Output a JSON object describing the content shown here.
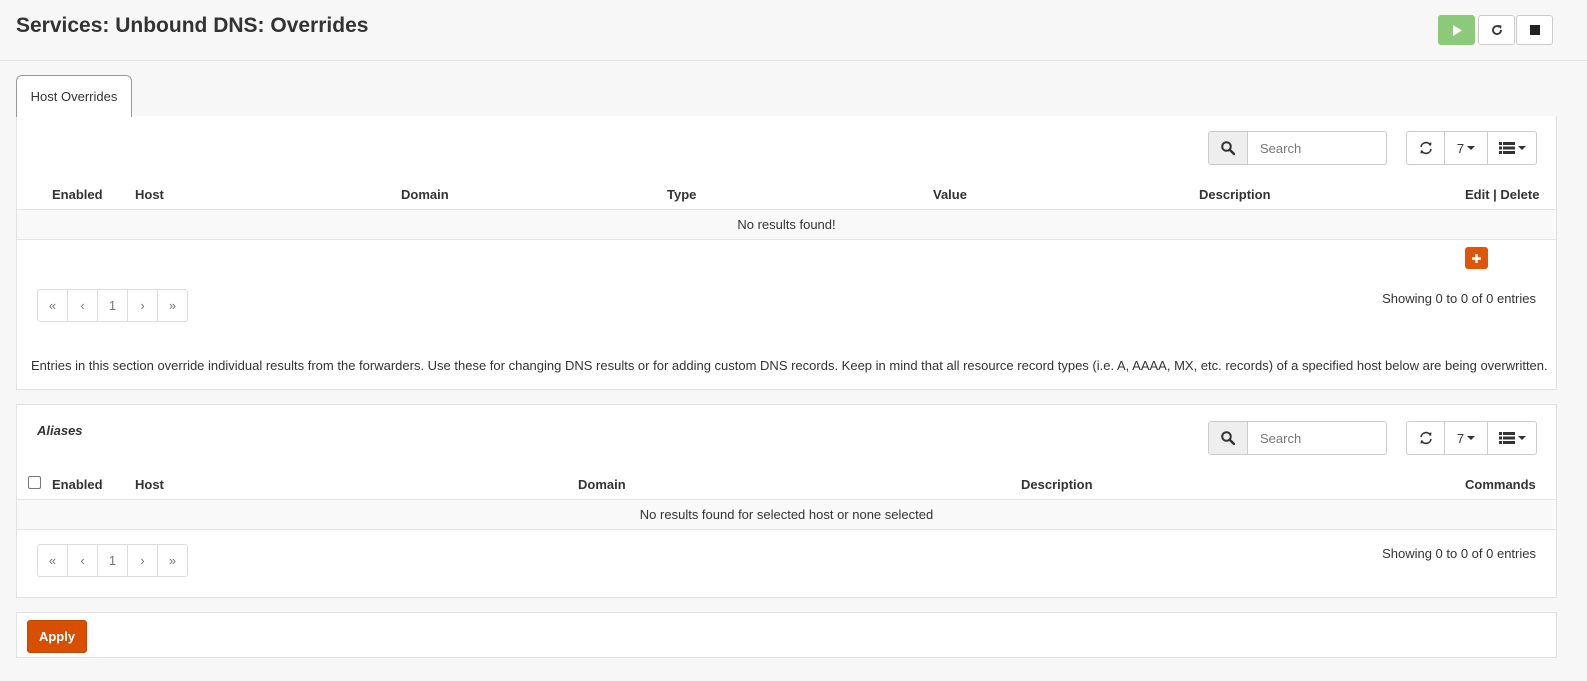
{
  "page": {
    "title": "Services: Unbound DNS: Overrides",
    "service_buttons": [
      "play-icon",
      "reload-icon",
      "stop-icon"
    ]
  },
  "tabs": [
    {
      "label": "Host Overrides",
      "active": true
    }
  ],
  "overrides_grid": {
    "search_placeholder": "Search",
    "page_size": "7",
    "columns": [
      "Enabled",
      "Host",
      "Domain",
      "Type",
      "Value",
      "Description",
      "Edit | Delete"
    ],
    "empty_message": "No results found!",
    "pagination": [
      "«",
      "‹",
      "1",
      "›",
      "»"
    ],
    "summary": "Showing 0 to 0 of 0 entries",
    "help_text": "Entries in this section override individual results from the forwarders. Use these for changing DNS results or for adding custom DNS records. Keep in mind that all resource record types (i.e. A, AAAA, MX, etc. records) of a specified host below are being overwritten."
  },
  "aliases_grid": {
    "title": "Aliases",
    "search_placeholder": "Search",
    "page_size": "7",
    "columns": [
      "Enabled",
      "Host",
      "Domain",
      "Description",
      "Commands"
    ],
    "empty_message": "No results found for selected host or none selected",
    "pagination": [
      "«",
      "‹",
      "1",
      "›",
      "»"
    ],
    "summary": "Showing 0 to 0 of 0 entries"
  },
  "actions": {
    "apply_label": "Apply"
  },
  "colors": {
    "accent": "#d94f00",
    "play_green": "#8cc97a"
  }
}
